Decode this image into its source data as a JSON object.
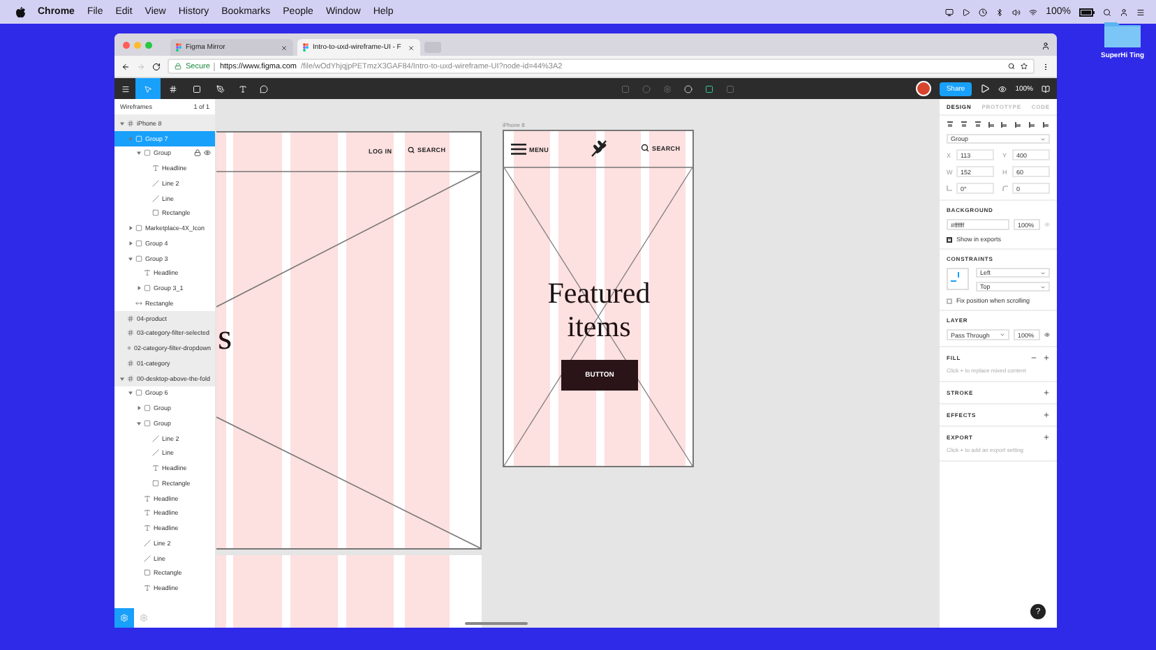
{
  "menubar": {
    "app": "Chrome",
    "items": [
      "File",
      "Edit",
      "View",
      "History",
      "Bookmarks",
      "People",
      "Window",
      "Help"
    ],
    "battery": "100%"
  },
  "desktop": {
    "folder": "SuperHi Ting"
  },
  "browser": {
    "tabs": [
      {
        "title": "Figma Mirror",
        "selected": false
      },
      {
        "title": "Intro-to-uxd-wireframe-UI - F",
        "selected": true
      }
    ],
    "secure_label": "Secure",
    "url_host": "https://www.figma.com",
    "url_path": "/file/wOdYhjqjpPETmzX3GAF84/Intro-to-uxd-wireframe-UI?node-id=44%3A2"
  },
  "toolbar": {
    "share": "Share",
    "zoom": "100%"
  },
  "layers_panel": {
    "page": "Wireframes",
    "page_count": "1 of 1",
    "layers": [
      {
        "name": "iPhone 8",
        "kind": "frame",
        "expanded": true,
        "selected": false,
        "children": [
          {
            "name": "Group 7",
            "kind": "group",
            "expanded": true,
            "selected": true,
            "children": [
              {
                "name": "Group",
                "kind": "group",
                "expanded": true,
                "selected": false,
                "locked": true,
                "children": [
                  {
                    "name": "Headline",
                    "kind": "text",
                    "selected": false
                  },
                  {
                    "name": "Line 2",
                    "kind": "line",
                    "selected": false
                  },
                  {
                    "name": "Line",
                    "kind": "line",
                    "selected": false
                  },
                  {
                    "name": "Rectangle",
                    "kind": "rect",
                    "selected": false
                  }
                ]
              }
            ]
          },
          {
            "name": "Marketplace-4X_Icon",
            "kind": "group",
            "expanded": false,
            "selected": false
          },
          {
            "name": "Group 4",
            "kind": "group",
            "expanded": false,
            "selected": false
          },
          {
            "name": "Group 3",
            "kind": "group",
            "expanded": true,
            "selected": false,
            "children": [
              {
                "name": "Headline",
                "kind": "text",
                "selected": false
              },
              {
                "name": "Group 3_1",
                "kind": "group",
                "expanded": false,
                "selected": false
              }
            ]
          },
          {
            "name": "Rectangle",
            "kind": "component",
            "selected": false
          }
        ]
      },
      {
        "name": "04-product",
        "kind": "frame",
        "selected": false
      },
      {
        "name": "03-category-filter-selected",
        "kind": "frame",
        "selected": false
      },
      {
        "name": "02-category-filter-dropdown",
        "kind": "frame",
        "selected": false
      },
      {
        "name": "01-category",
        "kind": "frame",
        "selected": false
      },
      {
        "name": "00-desktop-above-the-fold",
        "kind": "frame",
        "expanded": true,
        "selected": false,
        "children": [
          {
            "name": "Group 6",
            "kind": "group",
            "expanded": true,
            "selected": false,
            "children": [
              {
                "name": "Group",
                "kind": "group",
                "expanded": false,
                "selected": false
              },
              {
                "name": "Group",
                "kind": "group",
                "expanded": true,
                "selected": false,
                "children": [
                  {
                    "name": "Line 2",
                    "kind": "line",
                    "selected": false
                  },
                  {
                    "name": "Line",
                    "kind": "line",
                    "selected": false
                  },
                  {
                    "name": "Headline",
                    "kind": "text",
                    "selected": false
                  },
                  {
                    "name": "Rectangle",
                    "kind": "rect",
                    "selected": false
                  }
                ]
              },
              {
                "name": "Headline",
                "kind": "text",
                "selected": false
              },
              {
                "name": "Headline",
                "kind": "text",
                "selected": false
              },
              {
                "name": "Headline",
                "kind": "text",
                "selected": false
              },
              {
                "name": "Line 2",
                "kind": "line",
                "selected": false
              },
              {
                "name": "Line",
                "kind": "line",
                "selected": false
              },
              {
                "name": "Rectangle",
                "kind": "rect",
                "selected": false
              },
              {
                "name": "Headline",
                "kind": "text",
                "selected": false
              }
            ]
          }
        ]
      }
    ]
  },
  "canvas": {
    "desktop_frame": {
      "nav": [
        "LOG IN",
        "SEARCH"
      ],
      "headline_fragment": "s"
    },
    "phone_frame": {
      "label": "iPhone 8",
      "menu": "MENU",
      "search": "SEARCH",
      "headline": "Featured items",
      "button": "BUTTON"
    }
  },
  "design_panel": {
    "tabs": [
      {
        "label": "DESIGN",
        "selected": true
      },
      {
        "label": "PROTOTYPE",
        "selected": false
      },
      {
        "label": "CODE",
        "selected": false
      }
    ],
    "layer_kind": "Group",
    "fields": [
      {
        "kind": "text",
        "label": "X",
        "value": "113"
      },
      {
        "kind": "text",
        "label": "Y",
        "value": "400"
      },
      {
        "kind": "text",
        "label": "W",
        "value": "152"
      },
      {
        "kind": "text",
        "label": "H",
        "value": "60"
      },
      {
        "kind": "rotation",
        "value": "0°"
      },
      {
        "kind": "radius",
        "value": "0"
      }
    ],
    "background": {
      "title": "BACKGROUND",
      "hex": "#ffffff",
      "opacity": "100%",
      "show_label": "Show in exports",
      "show_in_exports": true
    },
    "constraints": {
      "title": "CONSTRAINTS",
      "horizontal": "Left",
      "vertical": "Top",
      "fix_label": "Fix position when scrolling",
      "fix_position": false
    },
    "layer": {
      "title": "LAYER",
      "blend": "Pass Through",
      "opacity": "100%"
    },
    "sections": [
      {
        "title": "FILL",
        "removable": true,
        "hint": "Click + to replace mixed content"
      },
      {
        "title": "STROKE",
        "removable": false
      },
      {
        "title": "EFFECTS",
        "removable": false
      },
      {
        "title": "EXPORT",
        "removable": false,
        "hint": "Click + to add an export setting"
      }
    ],
    "help": "?"
  }
}
